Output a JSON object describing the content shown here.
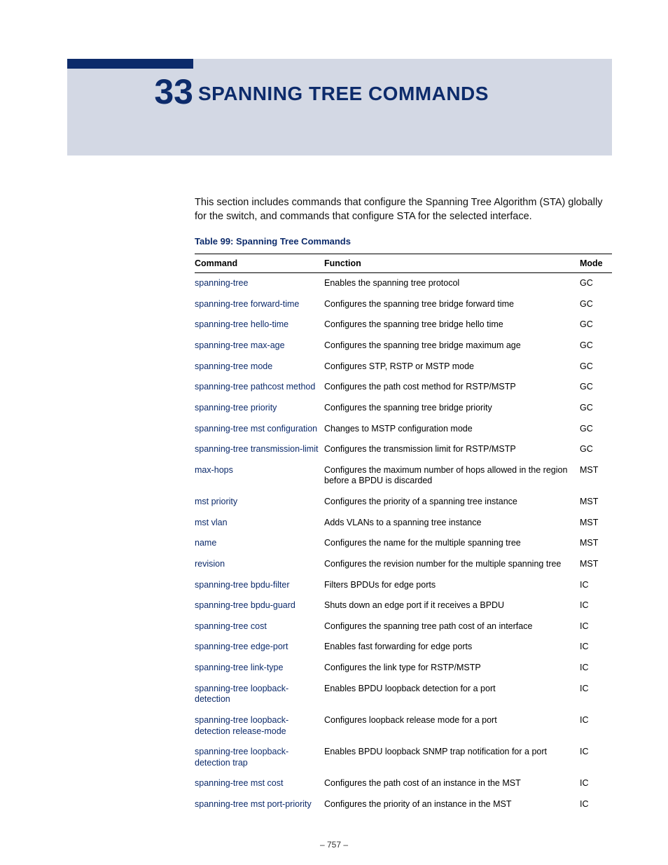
{
  "chapter": {
    "number": "33",
    "title": "SPANNING TREE COMMANDS"
  },
  "intro": "This section includes commands that configure the Spanning Tree Algorithm (STA) globally for the switch, and commands that configure STA for the selected interface.",
  "table_caption": "Table 99: Spanning Tree Commands",
  "columns": {
    "command": "Command",
    "function": "Function",
    "mode": "Mode"
  },
  "rows": [
    {
      "command": "spanning-tree",
      "function": "Enables the spanning tree protocol",
      "mode": "GC"
    },
    {
      "command": "spanning-tree forward-time",
      "function": "Configures the spanning tree bridge forward time",
      "mode": "GC"
    },
    {
      "command": "spanning-tree hello-time",
      "function": "Configures the spanning tree bridge hello time",
      "mode": "GC"
    },
    {
      "command": "spanning-tree max-age",
      "function": "Configures the spanning tree bridge maximum age",
      "mode": "GC"
    },
    {
      "command": "spanning-tree mode",
      "function": "Configures STP, RSTP or MSTP mode",
      "mode": "GC"
    },
    {
      "command": "spanning-tree pathcost method",
      "function": "Configures the path cost method for RSTP/MSTP",
      "mode": "GC"
    },
    {
      "command": "spanning-tree priority",
      "function": "Configures the spanning tree bridge priority",
      "mode": "GC"
    },
    {
      "command": "spanning-tree mst configuration",
      "function": "Changes to MSTP configuration mode",
      "mode": "GC"
    },
    {
      "command": "spanning-tree transmission-limit",
      "function": "Configures the transmission limit for RSTP/MSTP",
      "mode": "GC"
    },
    {
      "command": "max-hops",
      "function": "Configures the maximum number of hops allowed in the region before a BPDU is discarded",
      "mode": "MST"
    },
    {
      "command": "mst priority",
      "function": "Configures the priority of a spanning tree instance",
      "mode": "MST"
    },
    {
      "command": "mst vlan",
      "function": "Adds VLANs to a spanning tree instance",
      "mode": "MST"
    },
    {
      "command": "name",
      "function": "Configures the name for the multiple spanning tree",
      "mode": "MST"
    },
    {
      "command": "revision",
      "function": "Configures the revision number for the multiple spanning tree",
      "mode": "MST"
    },
    {
      "command": "spanning-tree bpdu-filter",
      "function": "Filters BPDUs for edge ports",
      "mode": "IC"
    },
    {
      "command": "spanning-tree bpdu-guard",
      "function": "Shuts down an edge port if it receives a BPDU",
      "mode": "IC"
    },
    {
      "command": "spanning-tree cost",
      "function": "Configures the spanning tree path cost of an interface",
      "mode": "IC"
    },
    {
      "command": "spanning-tree edge-port",
      "function": "Enables fast forwarding for edge ports",
      "mode": "IC"
    },
    {
      "command": "spanning-tree link-type",
      "function": "Configures the link type for RSTP/MSTP",
      "mode": "IC"
    },
    {
      "command": "spanning-tree loopback-detection",
      "function": "Enables BPDU loopback detection for a port",
      "mode": "IC"
    },
    {
      "command": "spanning-tree loopback-detection release-mode",
      "function": "Configures loopback release mode for a port",
      "mode": "IC"
    },
    {
      "command": "spanning-tree loopback-detection trap",
      "function": "Enables BPDU loopback SNMP trap notification for a port",
      "mode": "IC"
    },
    {
      "command": "spanning-tree mst cost",
      "function": "Configures the path cost of an instance in the MST",
      "mode": "IC"
    },
    {
      "command": "spanning-tree mst port-priority",
      "function": "Configures the priority of an instance in the MST",
      "mode": "IC"
    }
  ],
  "footer": "–  757  –"
}
